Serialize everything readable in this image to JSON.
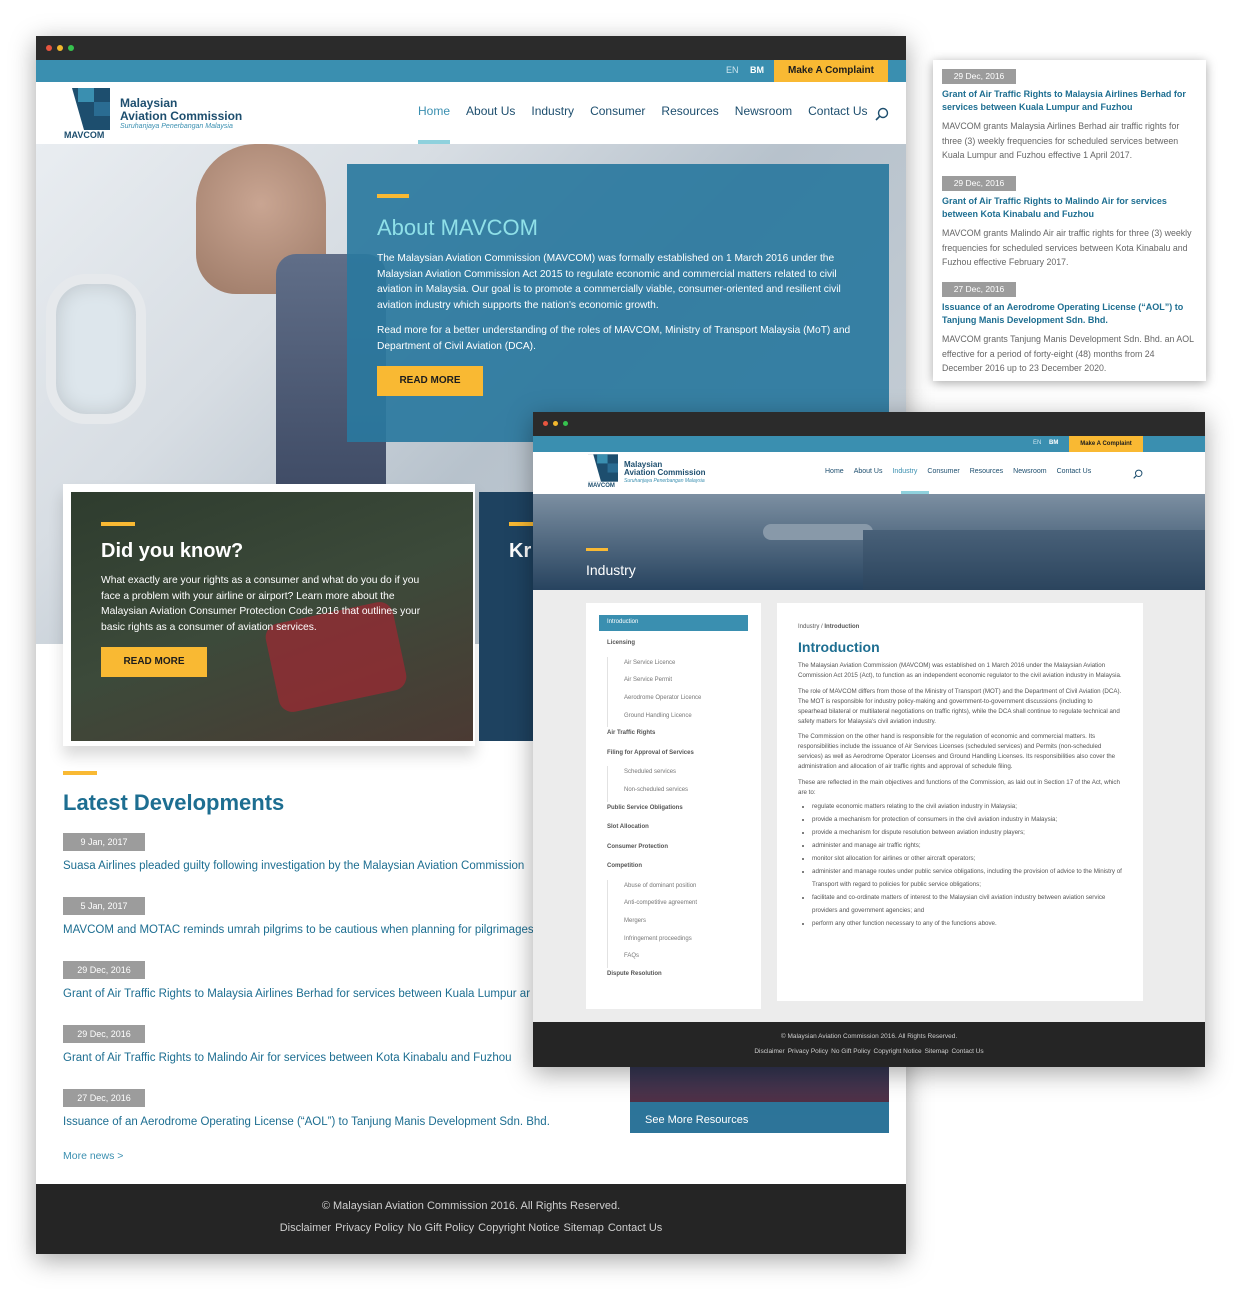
{
  "topbar": {
    "lang_en": "EN",
    "lang_bm": "BM",
    "complaint": "Make A Complaint"
  },
  "logo": {
    "line1": "Malaysian",
    "line2": "Aviation Commission",
    "tagline": "Suruhanjaya Penerbangan Malaysia",
    "short": "MAVCOM"
  },
  "nav": [
    "Home",
    "About Us",
    "Industry",
    "Consumer",
    "Resources",
    "Newsroom",
    "Contact Us"
  ],
  "hero": {
    "title": "About MAVCOM",
    "para1": "The Malaysian Aviation Commission (MAVCOM) was formally established on 1 March 2016 under the Malaysian Aviation Commission Act 2015 to regulate economic and commercial matters related to civil aviation in Malaysia. Our goal is to promote a commercially viable, consumer-oriented and resilient civil aviation industry which supports the nation's economic growth.",
    "para2": "Read more for a better understanding of the roles of MAVCOM, Ministry of Transport Malaysia (MoT) and Department of Civil Aviation (DCA).",
    "button": "READ MORE"
  },
  "did_you_know": {
    "title": "Did you know?",
    "body": "What exactly are your rights as a consumer and what do you do if you face a problem with your airline or airport? Learn more about the Malaysian Aviation Consumer Protection Code 2016 that outlines your basic rights as a consumer of aviation services.",
    "button": "READ MORE",
    "second_card_title": "Kr"
  },
  "latest": {
    "title": "Latest Developments",
    "items": [
      {
        "date": "9 Jan, 2017",
        "title": "Suasa Airlines pleaded guilty following investigation by the Malaysian Aviation Commission"
      },
      {
        "date": "5 Jan, 2017",
        "title": "MAVCOM and MOTAC reminds umrah pilgrims to be cautious when planning for pilgrimages"
      },
      {
        "date": "29 Dec, 2016",
        "title": "Grant of Air Traffic Rights to Malaysia Airlines Berhad for services between Kuala Lumpur ar"
      },
      {
        "date": "29 Dec, 2016",
        "title": "Grant of Air Traffic Rights to Malindo Air for services between Kota Kinabalu and Fuzhou"
      },
      {
        "date": "27 Dec, 2016",
        "title": "Issuance of an Aerodrome Operating License (“AOL”) to Tanjung Manis Development Sdn. Bhd."
      }
    ],
    "more": "More news >"
  },
  "resources": {
    "button": "See More Resources"
  },
  "footer": {
    "copyright": "© Malaysian Aviation Commission 2016. All Rights Reserved.",
    "links": [
      "Disclaimer",
      "Privacy Policy",
      "No Gift Policy",
      "Copyright Notice",
      "Sitemap",
      "Contact Us"
    ]
  },
  "news_panel": [
    {
      "date": "29 Dec, 2016",
      "title": "Grant of Air Traffic Rights to Malaysia Airlines Berhad for services between Kuala Lumpur and Fuzhou",
      "body": "MAVCOM grants Malaysia Airlines Berhad air traffic rights for three (3) weekly frequencies for scheduled services between Kuala Lumpur and Fuzhou effective 1 April 2017."
    },
    {
      "date": "29 Dec, 2016",
      "title": "Grant of Air Traffic Rights to Malindo Air for services between Kota Kinabalu and Fuzhou",
      "body": "MAVCOM grants Malindo Air air traffic rights for three (3) weekly frequencies for scheduled services between Kota Kinabalu and Fuzhou effective February 2017."
    },
    {
      "date": "27 Dec, 2016",
      "title": "Issuance of an Aerodrome Operating License (“AOL”) to Tanjung Manis Development Sdn. Bhd.",
      "body": "MAVCOM grants Tanjung Manis Development Sdn. Bhd. an AOL effective for a period of forty-eight (48) months from 24 December 2016 up to 23 December 2020."
    }
  ],
  "industry": {
    "banner_title": "Industry",
    "breadcrumb_parent": "Industry",
    "breadcrumb_sep": " / ",
    "breadcrumb_current": "Introduction",
    "title": "Introduction",
    "sidebar": [
      {
        "label": "Introduction",
        "level": 0,
        "active": true
      },
      {
        "label": "Licensing",
        "level": 0
      },
      {
        "label": "Air Service Licence",
        "level": 1
      },
      {
        "label": "Air Service Permit",
        "level": 1
      },
      {
        "label": "Aerodrome Operator Licence",
        "level": 1
      },
      {
        "label": "Ground Handling Licence",
        "level": 1
      },
      {
        "label": "Air Traffic Rights",
        "level": 0
      },
      {
        "label": "Filing for Approval of Services",
        "level": 0
      },
      {
        "label": "Scheduled services",
        "level": 1
      },
      {
        "label": "Non-scheduled services",
        "level": 1
      },
      {
        "label": "Public Service Obligations",
        "level": 0
      },
      {
        "label": "Slot Allocation",
        "level": 0
      },
      {
        "label": "Consumer Protection",
        "level": 0
      },
      {
        "label": "Competition",
        "level": 0
      },
      {
        "label": "Abuse of dominant position",
        "level": 1
      },
      {
        "label": "Anti-competitive agreement",
        "level": 1
      },
      {
        "label": "Mergers",
        "level": 1
      },
      {
        "label": "Infringement proceedings",
        "level": 1
      },
      {
        "label": "FAQs",
        "level": 1
      },
      {
        "label": "Dispute Resolution",
        "level": 0
      }
    ],
    "paragraphs": [
      "The Malaysian Aviation Commission (MAVCOM) was established on 1 March 2016 under the Malaysian Aviation Commission Act 2015 (Act), to function as an independent economic regulator to the civil aviation industry in Malaysia.",
      "The role of MAVCOM differs from those of the Ministry of Transport (MOT) and the Department of Civil Aviation (DCA). The MOT is responsible for industry policy-making and government-to-government discussions (including to spearhead bilateral or multilateral negotiations on traffic rights), while the DCA shall continue to regulate technical and safety matters for Malaysia's civil aviation industry.",
      "The Commission on the other hand is responsible for the regulation of economic and commercial matters. Its responsibilities include the issuance of Air Services Licenses (scheduled services) and Permits (non-scheduled services) as well as Aerodrome Operator Licenses and Ground Handling Licenses. Its responsibilities also cover the administration and allocation of air traffic rights and approval of schedule filing.",
      "These are reflected in the main objectives and functions of the Commission, as laid out in Section 17 of the Act, which are to:"
    ],
    "bullets": [
      "regulate economic matters relating to the civil aviation industry in Malaysia;",
      "provide a mechanism for protection of consumers in the civil aviation industry in Malaysia;",
      "provide a mechanism for dispute resolution between aviation industry players;",
      "administer and manage air traffic rights;",
      "monitor slot allocation for airlines or other aircraft operators;",
      "administer and manage routes under public service obligations, including the provision of advice to the Ministry of Transport with regard to policies for public service obligations;",
      "facilitate and co-ordinate matters of interest to the Malaysian civil aviation industry between aviation service providers and government agencies; and",
      "perform any other function necessary to any of the functions above."
    ]
  },
  "colors": {
    "teal": "#3a8fb0",
    "yellow": "#f9b933",
    "navy": "#1d4e6e",
    "footer": "#252525"
  }
}
